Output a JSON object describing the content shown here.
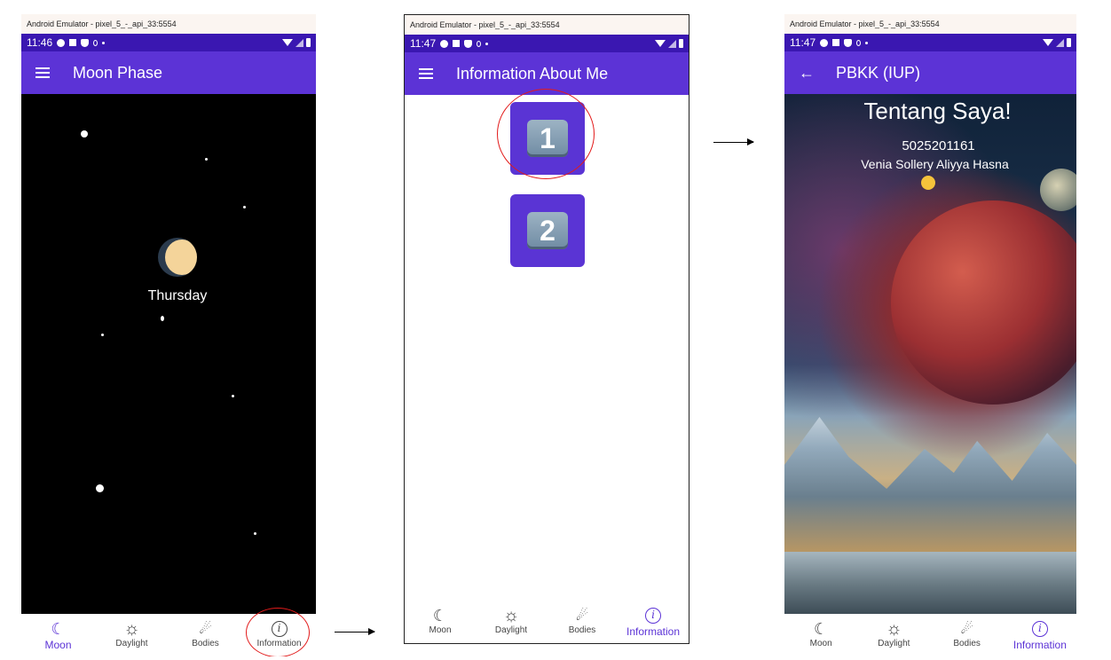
{
  "emulator_title": "Android Emulator - pixel_5_-_api_33:5554",
  "screen1": {
    "time": "11:46",
    "app_title": "Moon Phase",
    "day": "Thursday"
  },
  "screen2": {
    "time": "11:47",
    "app_title": "Information About Me",
    "tile1": "1",
    "tile2": "2"
  },
  "screen3": {
    "time": "11:47",
    "app_title": "PBKK (IUP)",
    "heading": "Tentang Saya!",
    "nrp": "5025201161",
    "name": "Venia Sollery Aliyya Hasna"
  },
  "nav": {
    "moon": "Moon",
    "daylight": "Daylight",
    "bodies": "Bodies",
    "information": "Information"
  },
  "colors": {
    "status_bar": "#3a17b1",
    "app_bar": "#5c33d6",
    "active_nav": "#5c33d6",
    "highlight": "#e21b1b"
  }
}
